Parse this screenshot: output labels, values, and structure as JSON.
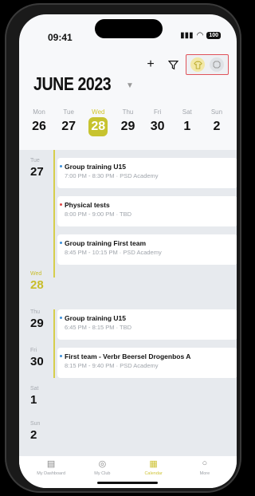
{
  "status": {
    "time": "09:41",
    "battery": "100"
  },
  "header": {
    "month": "JUNE 2023"
  },
  "week": [
    {
      "dow": "Mon",
      "num": "26"
    },
    {
      "dow": "Tue",
      "num": "27"
    },
    {
      "dow": "Wed",
      "num": "28"
    },
    {
      "dow": "Thu",
      "num": "29"
    },
    {
      "dow": "Fri",
      "num": "30"
    },
    {
      "dow": "Sat",
      "num": "1"
    },
    {
      "dow": "Sun",
      "num": "2"
    }
  ],
  "agenda": {
    "d27": {
      "dow": "Tue",
      "num": "27"
    },
    "d28": {
      "dow": "Wed",
      "num": "28"
    },
    "d29": {
      "dow": "Thu",
      "num": "29"
    },
    "d30": {
      "dow": "Fri",
      "num": "30"
    },
    "d1": {
      "dow": "Sat",
      "num": "1"
    },
    "d2": {
      "dow": "Sun",
      "num": "2"
    },
    "events": [
      {
        "title": "Group training U15",
        "sub": "7:00 PM - 8:30 PM · PSD Academy"
      },
      {
        "title": "Physical tests",
        "sub": "8:00 PM - 9:00 PM · TBD"
      },
      {
        "title": "Group training First team",
        "sub": "8:45 PM - 10:15 PM · PSD Academy"
      },
      {
        "title": "Group training U15",
        "sub": "6:45 PM - 8:15 PM · TBD"
      },
      {
        "title": "First team - Verbr Beersel Drogenbos A",
        "sub": "8:15 PM - 9:40 PM · PSD Academy"
      }
    ]
  },
  "tabs": [
    {
      "label": "My Dashboard",
      "icon": "dashboard-icon"
    },
    {
      "label": "My Club",
      "icon": "club-icon"
    },
    {
      "label": "Calendar",
      "icon": "calendar-icon"
    },
    {
      "label": "More",
      "icon": "more-icon"
    }
  ],
  "colors": {
    "accent": "#c7c32f",
    "highlight": "#e0525a",
    "event_dot": "#3c8ed8",
    "event_dot_alert": "#e04848"
  }
}
